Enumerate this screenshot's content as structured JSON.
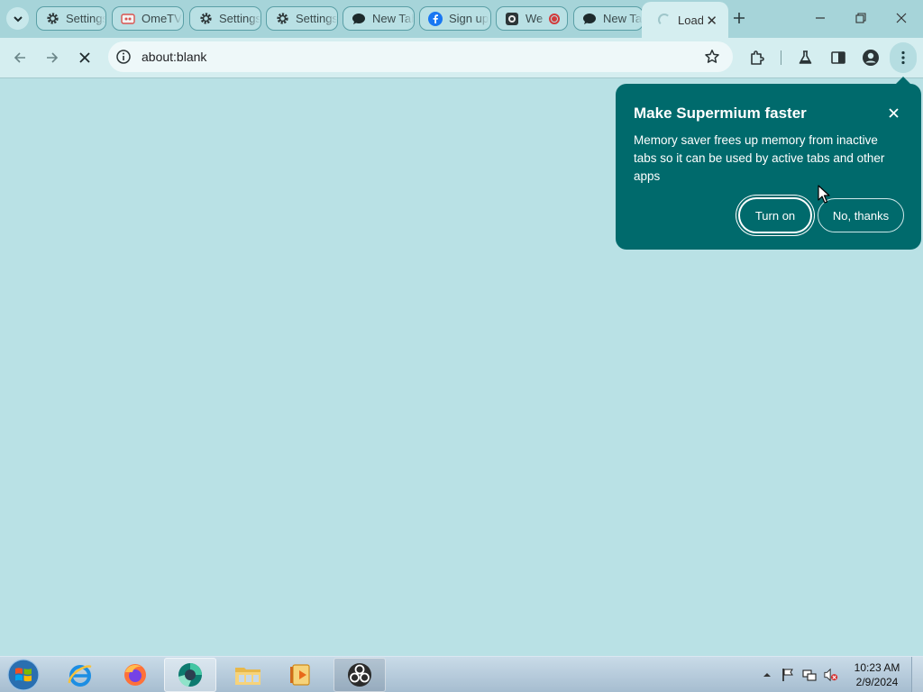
{
  "browser": {
    "tabs": [
      {
        "label": "Settings",
        "icon": "gear-icon"
      },
      {
        "label": "OmeTV",
        "icon": "ometv-icon"
      },
      {
        "label": "Settings",
        "icon": "gear-icon"
      },
      {
        "label": "Settings",
        "icon": "gear-icon"
      },
      {
        "label": "New Tab",
        "icon": "chat-bubble-icon"
      },
      {
        "label": "Sign up",
        "icon": "facebook-icon"
      },
      {
        "label": "We",
        "icon": "webcam-icon"
      },
      {
        "label": "New Tab",
        "icon": "chat-bubble-icon"
      }
    ],
    "active_tab": {
      "label": "Loading",
      "icon": "loading-spinner-icon"
    },
    "url": "about:blank"
  },
  "bubble": {
    "title": "Make Supermium faster",
    "body": "Memory saver frees up memory from inactive tabs so it can be used by active tabs and other apps",
    "primary_button": "Turn on",
    "secondary_button": "No, thanks"
  },
  "taskbar": {
    "time": "10:23 AM",
    "date": "2/9/2024",
    "apps": [
      "internet-explorer-icon",
      "firefox-icon",
      "supermium-icon",
      "file-explorer-icon",
      "media-player-icon",
      "obs-icon"
    ]
  },
  "colors": {
    "page_background": "#b9e1e5",
    "tab_strip": "#a6d4d9",
    "toolbar": "#d5eef0",
    "bubble": "#006a6c"
  }
}
